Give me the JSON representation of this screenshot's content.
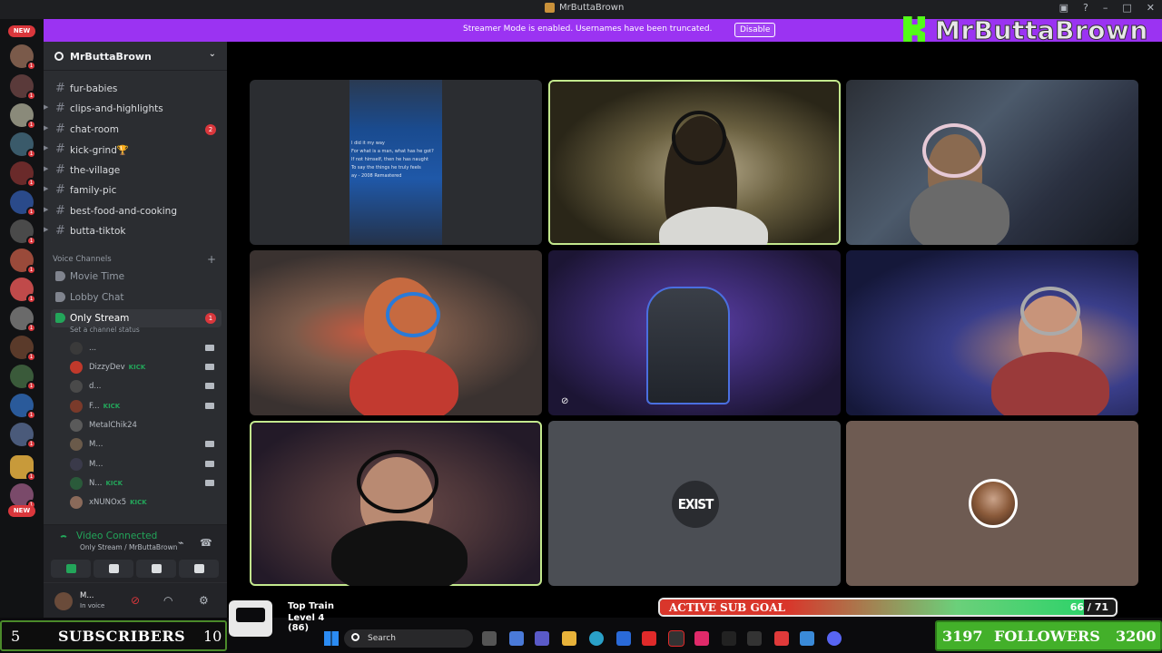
{
  "window": {
    "title": "MrButtaBrown"
  },
  "banner": {
    "message": "Streamer Mode is enabled. Usernames have been truncated.",
    "button": "Disable"
  },
  "brand": {
    "name": "MrButtaBrown"
  },
  "rail": {
    "new_top": "NEW",
    "new_bottom": "NEW",
    "unread": "1"
  },
  "server": {
    "name": "MrButtaBrown"
  },
  "text_channels": [
    {
      "label": "fur-babies",
      "badge": ""
    },
    {
      "label": "clips-and-highlights",
      "badge": ""
    },
    {
      "label": "chat-room",
      "badge": "2"
    },
    {
      "label": "kick-grind🏆",
      "badge": ""
    },
    {
      "label": "the-village",
      "badge": ""
    },
    {
      "label": "family-pic",
      "badge": ""
    },
    {
      "label": "best-food-and-cooking",
      "badge": ""
    },
    {
      "label": "butta-tiktok",
      "badge": ""
    }
  ],
  "voice": {
    "category": "Voice Channels",
    "channels": [
      {
        "label": "Movie Time",
        "badge": ""
      },
      {
        "label": "Lobby Chat",
        "badge": ""
      },
      {
        "label": "Only Stream",
        "badge": "1"
      }
    ],
    "status_hint": "Set a channel status",
    "users": [
      {
        "name": "...",
        "kick": ""
      },
      {
        "name": "DizzyDev",
        "kick": "KICK"
      },
      {
        "name": "d...",
        "kick": ""
      },
      {
        "name": "F...",
        "kick": "KICK"
      },
      {
        "name": "MetalChik24",
        "kick": ""
      },
      {
        "name": "M...",
        "kick": ""
      },
      {
        "name": "M...",
        "kick": ""
      },
      {
        "name": "N...",
        "kick": "KICK"
      },
      {
        "name": "xNUNOx5",
        "kick": "KICK"
      }
    ]
  },
  "voice_panel": {
    "status": "Video Connected",
    "channel": "Only Stream / MrButtaBrown"
  },
  "user_panel": {
    "name": "M...",
    "status": "In voice"
  },
  "tiles": {
    "screen_share_lyrics": [
      "I did it my way",
      "For what is a man, what has he got?",
      "If not himself, then he has naught",
      "To say the things he truly feels",
      "",
      "ay - 2008 Remastered"
    ],
    "exist_logo": "EXIST"
  },
  "overlay": {
    "subs_left": "5",
    "subs_label": "SUBSCRIBERS",
    "subs_right": "10",
    "subs_progress": 0,
    "followers_current": "3197",
    "followers_label": "FOLLOWERS",
    "followers_goal": "3200",
    "train_title": "Top Train",
    "train_level": "Level 4 (86)",
    "goal_label": "ACTIVE SUB GOAL",
    "goal_value": "66 / 71",
    "goal_progress": 0.93
  },
  "taskbar": {
    "search_placeholder": "Search"
  },
  "colors": {
    "brand_purple": "#9b33f2",
    "kick_green": "#53fc18",
    "discord_red": "#da373c",
    "online_green": "#23a55a"
  }
}
